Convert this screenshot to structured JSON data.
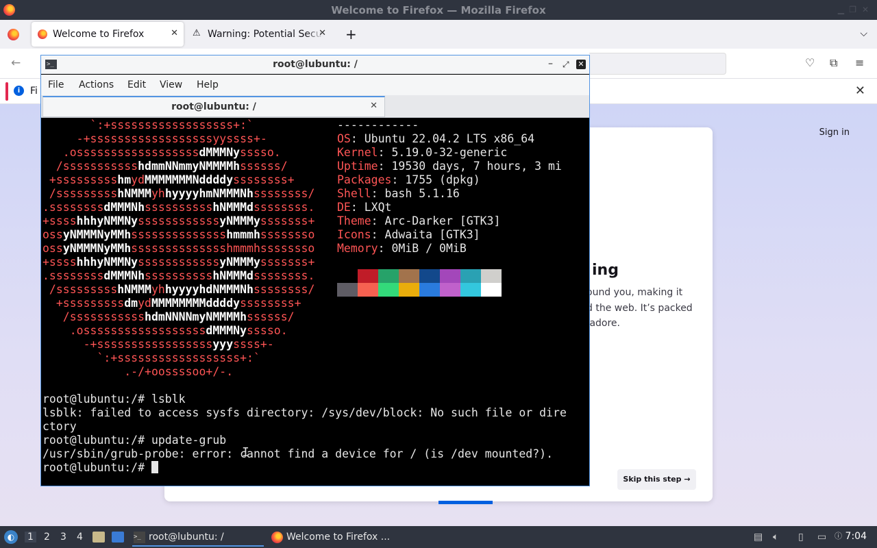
{
  "firefox": {
    "window_title": "Welcome to Firefox — Mozilla Firefox",
    "tabs": [
      {
        "label": "Welcome to Firefox"
      },
      {
        "label": "Warning: Potential Security Risk Ahead"
      }
    ],
    "notice_text": "Fi",
    "sign_in": "Sign in",
    "card_heading": "ing",
    "card_body": "ound you, making it\nd the web. It’s packed\n adore.",
    "skip_button": "Skip this step →"
  },
  "terminal": {
    "title": "root@lubuntu: /",
    "menu": [
      "File",
      "Actions",
      "Edit",
      "View",
      "Help"
    ],
    "tab_label": "root@lubuntu: /",
    "ascii_art": [
      "       `:+ssssssssssssssssss+:`",
      "     -+ssssssssssssssssssyyssss+-",
      "   .ossssssssssssssssss|dMMMNy|sssso.",
      "  /sssssssssss|hdmmNNmmyNMMMMh|ssssss/",
      " +sssssssss|hm|yd|MMMMMMMNddddy|ssssssss+",
      " /sssssssss|hNMMM|yh|hyyyyhmNMMMNh|ssssssss/",
      ".ssssssss|dMMMNh|ssssssssss|hNMMMd|ssssssss.",
      "+ssss|hhhyNMMNy|ssssssssssss|yNMMMy|sssssss+",
      "oss|yNMMMNyMMh|ssssssssssssss|hmmmh|ssssssso",
      "oss|yNMMMNyMMh|sssssssssssssshmmmhssssssso",
      "+ssss|hhhyNMMNy|ssssssssssss|yNMMMy|sssssss+",
      ".ssssssss|dMMMNh|ssssssssss|hNMMMd|ssssssss.",
      " /sssssssss|hNMMM|yh|hyyyyhdNMMMNh|ssssssss/",
      "  +sssssssss|dm|yd|MMMMMMMMddddy|ssssssss+",
      "   /sssssssssss|hdmNNNNmyNMMMMh|ssssss/",
      "    .ossssssssssssssssss|dMMMNy|sssso.",
      "      -+sssssssssssssssss|yyy|ssss+-",
      "        `:+ssssssssssssssssss+:`",
      "            .-/+oossssoo+/-."
    ],
    "sysinfo_separator": "------------",
    "sysinfo": [
      {
        "key": "OS",
        "value": "Ubuntu 22.04.2 LTS x86_64"
      },
      {
        "key": "Kernel",
        "value": "5.19.0-32-generic"
      },
      {
        "key": "Uptime",
        "value": "19530 days, 7 hours, 3 mi"
      },
      {
        "key": "Packages",
        "value": "1755 (dpkg)"
      },
      {
        "key": "Shell",
        "value": "bash 5.1.16"
      },
      {
        "key": "DE",
        "value": "LXQt"
      },
      {
        "key": "Theme",
        "value": "Arc-Darker [GTK3]"
      },
      {
        "key": "Icons",
        "value": "Adwaita [GTK3]"
      },
      {
        "key": "Memory",
        "value": "0MiB / 0MiB"
      }
    ],
    "palette_row1": [
      "#000000",
      "#c01c28",
      "#26a269",
      "#a2734c",
      "#12488b",
      "#a347ba",
      "#2aa1b3",
      "#d0cfcc"
    ],
    "palette_row2": [
      "#5e5c64",
      "#f66151",
      "#33da7a",
      "#e9ad0c",
      "#2a7bde",
      "#c061cb",
      "#33c7de",
      "#ffffff"
    ],
    "output": [
      "root@lubuntu:/# lsblk",
      "lsblk: failed to access sysfs directory: /sys/dev/block: No such file or dire",
      "ctory",
      "root@lubuntu:/# update-grub",
      "/usr/sbin/grub-probe: error: cannot find a device for / (is /dev mounted?).",
      "root@lubuntu:/# "
    ]
  },
  "taskbar": {
    "workspaces": [
      "1",
      "2",
      "3",
      "4"
    ],
    "tasks": [
      {
        "label": "root@lubuntu: /"
      },
      {
        "label": "Welcome to Firefox ..."
      }
    ],
    "clock": "7:04"
  }
}
